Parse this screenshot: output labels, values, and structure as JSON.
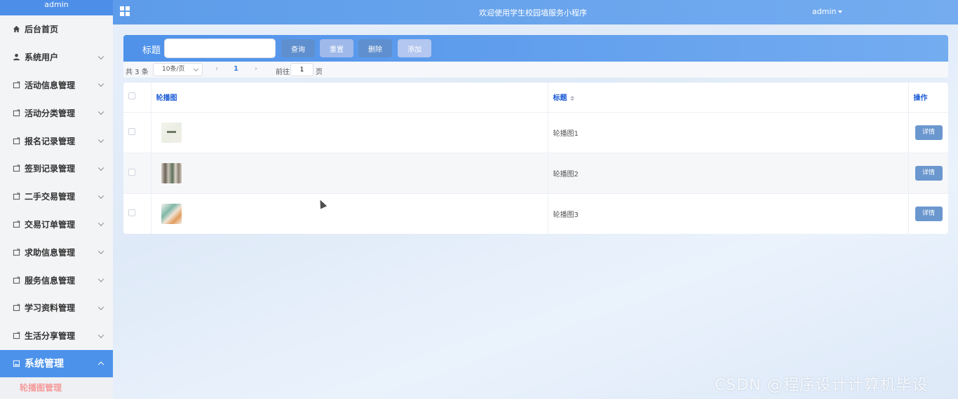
{
  "sidebar": {
    "header": "admin",
    "items": [
      {
        "label": "后台首页",
        "icon": "home-icon",
        "expandable": false
      },
      {
        "label": "系统用户",
        "icon": "user-icon",
        "expandable": true
      },
      {
        "label": "活动信息管理",
        "icon": "folder-icon",
        "expandable": true
      },
      {
        "label": "活动分类管理",
        "icon": "folder-icon",
        "expandable": true
      },
      {
        "label": "报名记录管理",
        "icon": "folder-icon",
        "expandable": true
      },
      {
        "label": "签到记录管理",
        "icon": "folder-icon",
        "expandable": true
      },
      {
        "label": "二手交易管理",
        "icon": "folder-icon",
        "expandable": true
      },
      {
        "label": "交易订单管理",
        "icon": "folder-icon",
        "expandable": true
      },
      {
        "label": "求助信息管理",
        "icon": "folder-icon",
        "expandable": true
      },
      {
        "label": "服务信息管理",
        "icon": "folder-icon",
        "expandable": true
      },
      {
        "label": "学习资料管理",
        "icon": "folder-icon",
        "expandable": true
      },
      {
        "label": "生活分享管理",
        "icon": "folder-icon",
        "expandable": true
      },
      {
        "label": "系统管理",
        "icon": "image-icon",
        "expandable": true,
        "active": true
      }
    ],
    "submenu": {
      "label": "轮播图管理"
    }
  },
  "topbar": {
    "site_title": "欢迎使用学生校园墙服务小程序",
    "user": "admin"
  },
  "search": {
    "label": "标题",
    "placeholder": "",
    "value": "",
    "query_label": "查询",
    "reset_label": "重置",
    "delete_label": "删除",
    "add_label": "添加"
  },
  "pager": {
    "total": "共 3 条",
    "page_size": "10条/页",
    "current_page": "1",
    "goto_label": "前往",
    "goto_value": "1",
    "page_suffix": "页"
  },
  "table": {
    "columns": {
      "image": "轮播图",
      "title": "标题",
      "action": "操作"
    },
    "rows": [
      {
        "title": "轮播图1",
        "action": "详情"
      },
      {
        "title": "轮播图2",
        "action": "详情"
      },
      {
        "title": "轮播图3",
        "action": "详情"
      }
    ]
  },
  "watermark": "CSDN @程序设计计算机毕设",
  "colors": {
    "accent": "#4c92ea",
    "header_text": "#1b5bd6",
    "submenu_text": "#f59a9a"
  }
}
